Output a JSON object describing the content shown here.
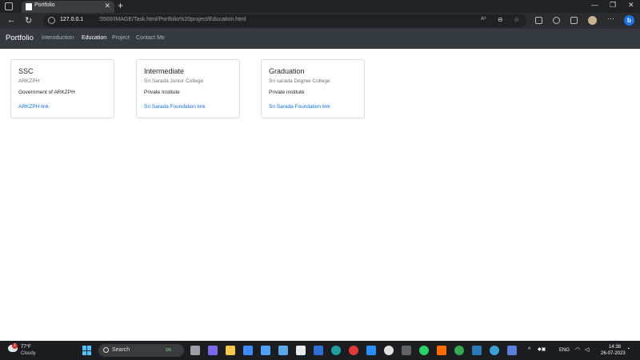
{
  "browser": {
    "tab_title": "Portfolio",
    "url_host": "127.0.0.1",
    "url_path": ":5500/IMAGE/Task.html/Portfolio%20project/Education.html"
  },
  "site": {
    "brand": "Portfolio",
    "nav": [
      {
        "label": "interoduction",
        "active": false
      },
      {
        "label": "Education",
        "active": true
      },
      {
        "label": "Project",
        "active": false
      },
      {
        "label": "Contact Me",
        "active": false
      }
    ]
  },
  "cards": [
    {
      "title": "SSC",
      "subtitle": "ARKZPH",
      "text": "Government of ARKZPH",
      "link": "ARKZPH link"
    },
    {
      "title": "Intermediate",
      "subtitle": "Sri Sarada Junior College",
      "text": "Private Institute",
      "link": "Sri Sarada Foundation link"
    },
    {
      "title": "Graduation",
      "subtitle": "Sri sarada Degree College",
      "text": "Private institute",
      "link": "Sri Sarada Foundation link"
    }
  ],
  "taskbar": {
    "temperature": "77°F",
    "condition": "Cloudy",
    "weather_badge": "1",
    "search_label": "Search",
    "language": "ENG",
    "time": "14:38",
    "date": "26-07-2023"
  }
}
